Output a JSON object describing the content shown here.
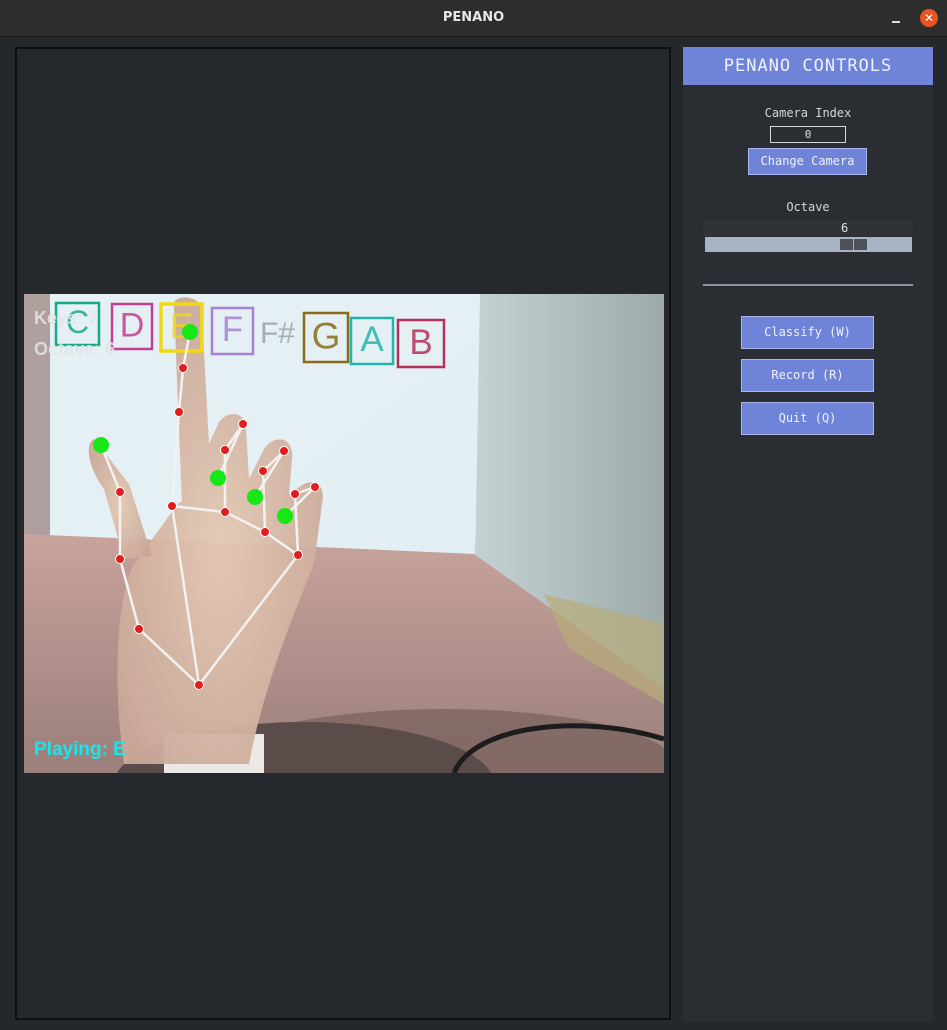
{
  "window": {
    "title": "PENANO"
  },
  "video": {
    "overlay": {
      "keys_label": "Keys: 7",
      "octave_label": "Octave: 6",
      "playing_label": "Playing: E"
    },
    "keys": [
      {
        "note": "C",
        "color": "#1aa889"
      },
      {
        "note": "D",
        "color": "#c23e92"
      },
      {
        "note": "E",
        "color": "#f2d812",
        "active": true
      },
      {
        "note": "F",
        "color": "#a980d8"
      },
      {
        "note": "F#",
        "color": "#9ea2a8"
      },
      {
        "note": "G",
        "color": "#8a6b1c"
      },
      {
        "note": "A",
        "color": "#22b5b0"
      },
      {
        "note": "B",
        "color": "#b4305a"
      }
    ],
    "colors": {
      "landmark": "#e21d1d",
      "fingertip": "#15e815",
      "bone": "#f2f2f2",
      "playing": "#17e6ee"
    }
  },
  "controls": {
    "header": "PENANO CONTROLS",
    "camera_index_label": "Camera Index",
    "camera_index_value": "0",
    "change_camera_label": "Change Camera",
    "octave_label": "Octave",
    "octave_value": "6",
    "octave_min": 0,
    "octave_max": 8,
    "classify_label": "Classify (W)",
    "record_label": "Record (R)",
    "quit_label": "Quit (Q)"
  }
}
